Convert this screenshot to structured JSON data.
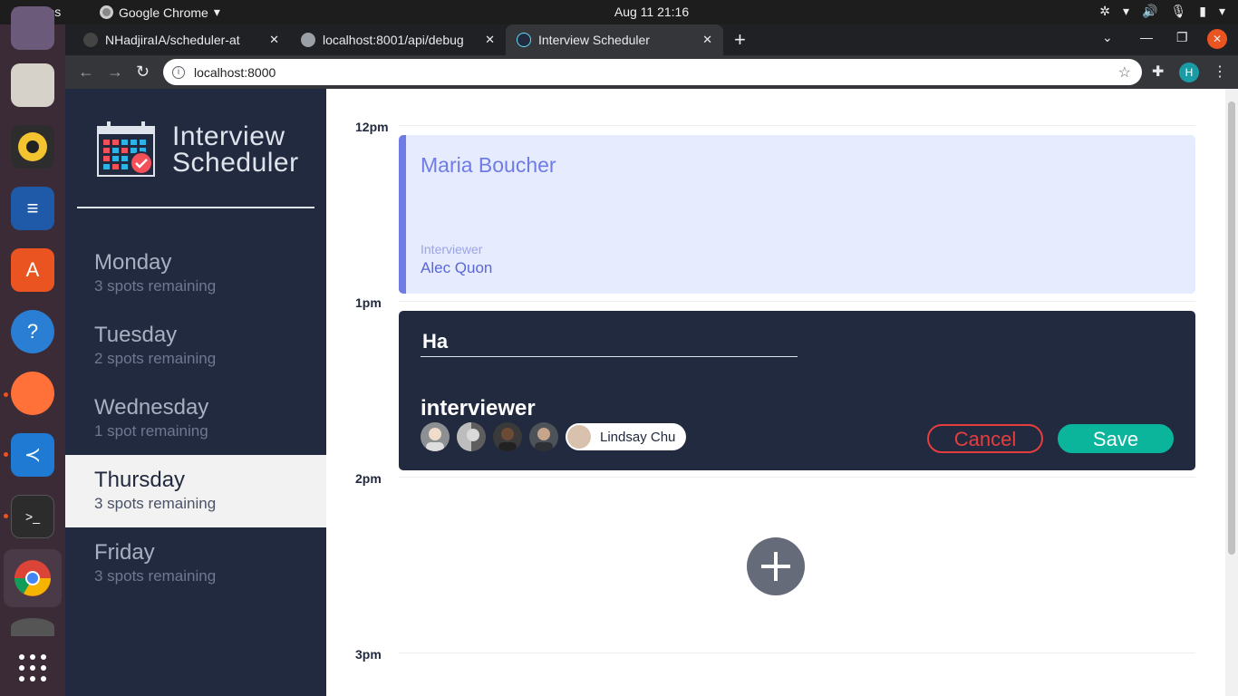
{
  "system": {
    "activities": "Activities",
    "app_name": "Google Chrome",
    "clock": "Aug 11  21:16"
  },
  "browser": {
    "tabs": [
      {
        "label": "NHadjiraIA/scheduler-at",
        "icon": "github-icon"
      },
      {
        "label": "localhost:8001/api/debug",
        "icon": "globe-icon"
      },
      {
        "label": "Interview Scheduler",
        "icon": "react-icon"
      }
    ],
    "url": "localhost:8000",
    "profile_initial": "H"
  },
  "app": {
    "brand": {
      "line1": "Interview",
      "line2": "Scheduler"
    },
    "days": [
      {
        "name": "Monday",
        "spots": "3 spots remaining"
      },
      {
        "name": "Tuesday",
        "spots": "2 spots remaining"
      },
      {
        "name": "Wednesday",
        "spots": "1 spot remaining"
      },
      {
        "name": "Thursday",
        "spots": "3 spots remaining",
        "selected": true
      },
      {
        "name": "Friday",
        "spots": "3 spots remaining"
      }
    ],
    "times": [
      "12pm",
      "1pm",
      "2pm",
      "3pm"
    ],
    "booked": {
      "student": "Maria Boucher",
      "interviewer_label": "Interviewer",
      "interviewer": "Alec Quon"
    },
    "form": {
      "student_value": "Ha",
      "interviewer_heading": "interviewer",
      "selected_interviewer": "Lindsay Chu",
      "cancel": "Cancel",
      "save": "Save"
    }
  },
  "colors": {
    "sidebar": "#222a3f",
    "accent_purple": "#6f7ce5",
    "save_green": "#0ab59c",
    "cancel_red": "#e53e3e"
  }
}
